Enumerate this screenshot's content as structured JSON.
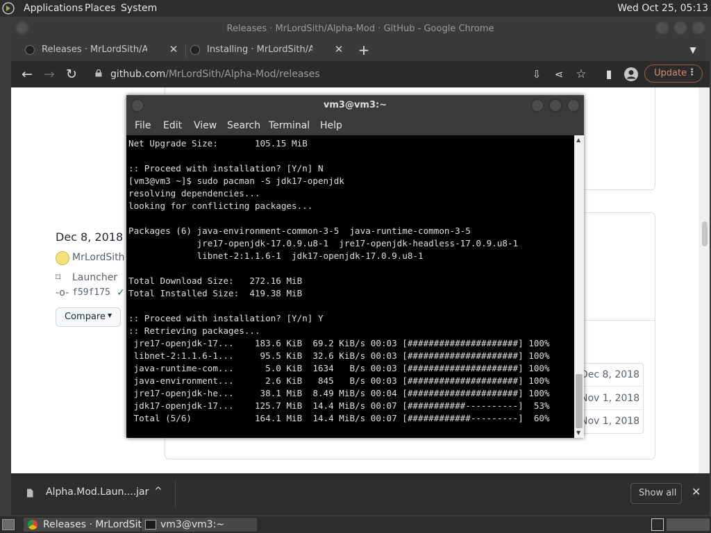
{
  "panel": {
    "menus": [
      "Applications",
      "Places",
      "System"
    ],
    "clock": "Wed Oct 25, 05:13"
  },
  "browser": {
    "window_title": "Releases · MrLordSith/Alpha-Mod · GitHub - Google Chrome",
    "tabs": [
      {
        "label": "Releases · MrLordSith/Alpha-Mod"
      },
      {
        "label": "Installing · MrLordSith/Alpha-Mod"
      }
    ],
    "url_host": "github.com",
    "url_path": "/MrLordSith/Alpha-Mod/releases",
    "update_label": "Update"
  },
  "release": {
    "date": "Dec 8, 2018",
    "author": "MrLordSith",
    "tag": "Launcher",
    "commit": "f59f175",
    "compare_label": "Compare",
    "asset_dates": [
      "Dec 8, 2018",
      "Nov 1, 2018",
      "Nov 1, 2018"
    ]
  },
  "downloads": {
    "file": "Alpha.Mod.Laun....jar",
    "show_all": "Show all"
  },
  "terminal": {
    "title": "vm3@vm3:~",
    "menu": [
      "File",
      "Edit",
      "View",
      "Search",
      "Terminal",
      "Help"
    ],
    "lines": [
      "Net Upgrade Size:       105.15 MiB",
      "",
      ":: Proceed with installation? [Y/n] N",
      "[vm3@vm3 ~]$ sudo pacman -S jdk17-openjdk",
      "resolving dependencies...",
      "looking for conflicting packages...",
      "",
      "Packages (6) java-environment-common-3-5  java-runtime-common-3-5",
      "             jre17-openjdk-17.0.9.u8-1  jre17-openjdk-headless-17.0.9.u8-1",
      "             libnet-2:1.1.6-1  jdk17-openjdk-17.0.9.u8-1",
      "",
      "Total Download Size:   272.16 MiB",
      "Total Installed Size:  419.38 MiB",
      "",
      ":: Proceed with installation? [Y/n] Y",
      ":: Retrieving packages...",
      " jre17-openjdk-17...    183.6 KiB  69.2 KiB/s 00:03 [#####################] 100%",
      " libnet-2:1.1.6-1...     95.5 KiB  32.6 KiB/s 00:03 [#####################] 100%",
      " java-runtime-com...      5.0 KiB  1634   B/s 00:03 [#####################] 100%",
      " java-environment...      2.6 KiB   845   B/s 00:03 [#####################] 100%",
      " jre17-openjdk-he...     38.1 MiB  8.49 MiB/s 00:04 [#####################] 100%",
      " jdk17-openjdk-17...    125.7 MiB  14.4 MiB/s 00:07 [###########----------]  53%",
      " Total (5/6)            164.1 MiB  14.4 MiB/s 00:07 [############---------]  60%"
    ]
  },
  "taskbar": {
    "tasks": [
      "Releases · MrLordSit...",
      "vm3@vm3:~"
    ]
  },
  "colors": {
    "panel_bg": "#2c2c2c",
    "terminal_bg": "#000000",
    "update_accent": "#d88a6a"
  }
}
